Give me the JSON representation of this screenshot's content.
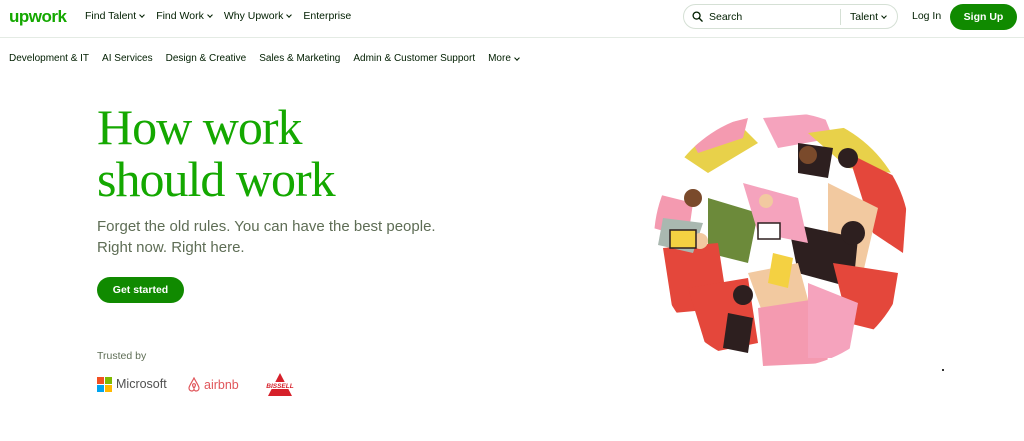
{
  "brand": {
    "logo_text": "upwork",
    "accent": "#14a800",
    "button_green": "#108a00"
  },
  "topnav": {
    "links": [
      {
        "label": "Find Talent",
        "has_dropdown": true
      },
      {
        "label": "Find Work",
        "has_dropdown": true
      },
      {
        "label": "Why Upwork",
        "has_dropdown": true
      },
      {
        "label": "Enterprise",
        "has_dropdown": false
      }
    ],
    "search": {
      "placeholder": "Search",
      "scope": "Talent"
    },
    "login": "Log In",
    "signup": "Sign Up"
  },
  "categories": [
    {
      "label": "Development & IT"
    },
    {
      "label": "AI Services"
    },
    {
      "label": "Design & Creative"
    },
    {
      "label": "Sales & Marketing"
    },
    {
      "label": "Admin & Customer Support"
    },
    {
      "label": "More",
      "has_dropdown": true
    }
  ],
  "hero": {
    "title_line1": "How work",
    "title_line2": "should work",
    "subtitle_line1": "Forget the old rules. You can have the best people.",
    "subtitle_line2": "Right now. Right here.",
    "cta": "Get started"
  },
  "trusted": {
    "label": "Trusted by",
    "logos": [
      {
        "name": "Microsoft",
        "text": "Microsoft",
        "icon": "microsoft-logo"
      },
      {
        "name": "airbnb",
        "text": "airbnb",
        "icon": "airbnb-logo"
      },
      {
        "name": "BISSELL",
        "text": "BISSELL",
        "icon": "bissell-logo"
      }
    ]
  }
}
